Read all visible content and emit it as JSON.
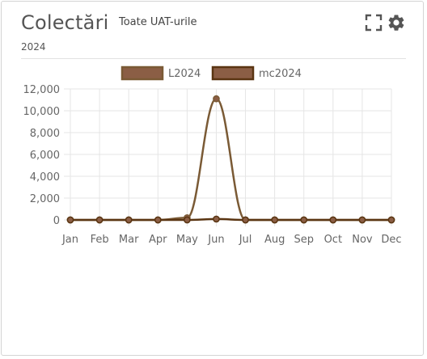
{
  "header": {
    "title": "Colectări",
    "subtitle": "Toate UAT-urile",
    "year": "2024"
  },
  "icons": {
    "fullscreen": "fullscreen-icon",
    "settings": "gear-icon"
  },
  "colors": {
    "series_fill": "#8b5e45",
    "series_line_L2024": "#7a5a35",
    "series_line_mc2024": "#5a3512",
    "grid": "#e5e5e5"
  },
  "chart_data": {
    "type": "line",
    "categories": [
      "Jan",
      "Feb",
      "Mar",
      "Apr",
      "May",
      "Jun",
      "Jul",
      "Aug",
      "Sep",
      "Oct",
      "Nov",
      "Dec"
    ],
    "series": [
      {
        "name": "L2024",
        "values": [
          0,
          0,
          0,
          0,
          200,
          11100,
          0,
          0,
          0,
          0,
          0,
          0
        ]
      },
      {
        "name": "mc2024",
        "values": [
          0,
          0,
          0,
          0,
          0,
          80,
          0,
          0,
          0,
          0,
          0,
          0
        ]
      }
    ],
    "yticks": [
      "0",
      "2,000",
      "4,000",
      "6,000",
      "8,000",
      "10,000",
      "12,000"
    ],
    "ylim": [
      0,
      12000
    ],
    "grid": true,
    "legend_position": "top-center"
  }
}
